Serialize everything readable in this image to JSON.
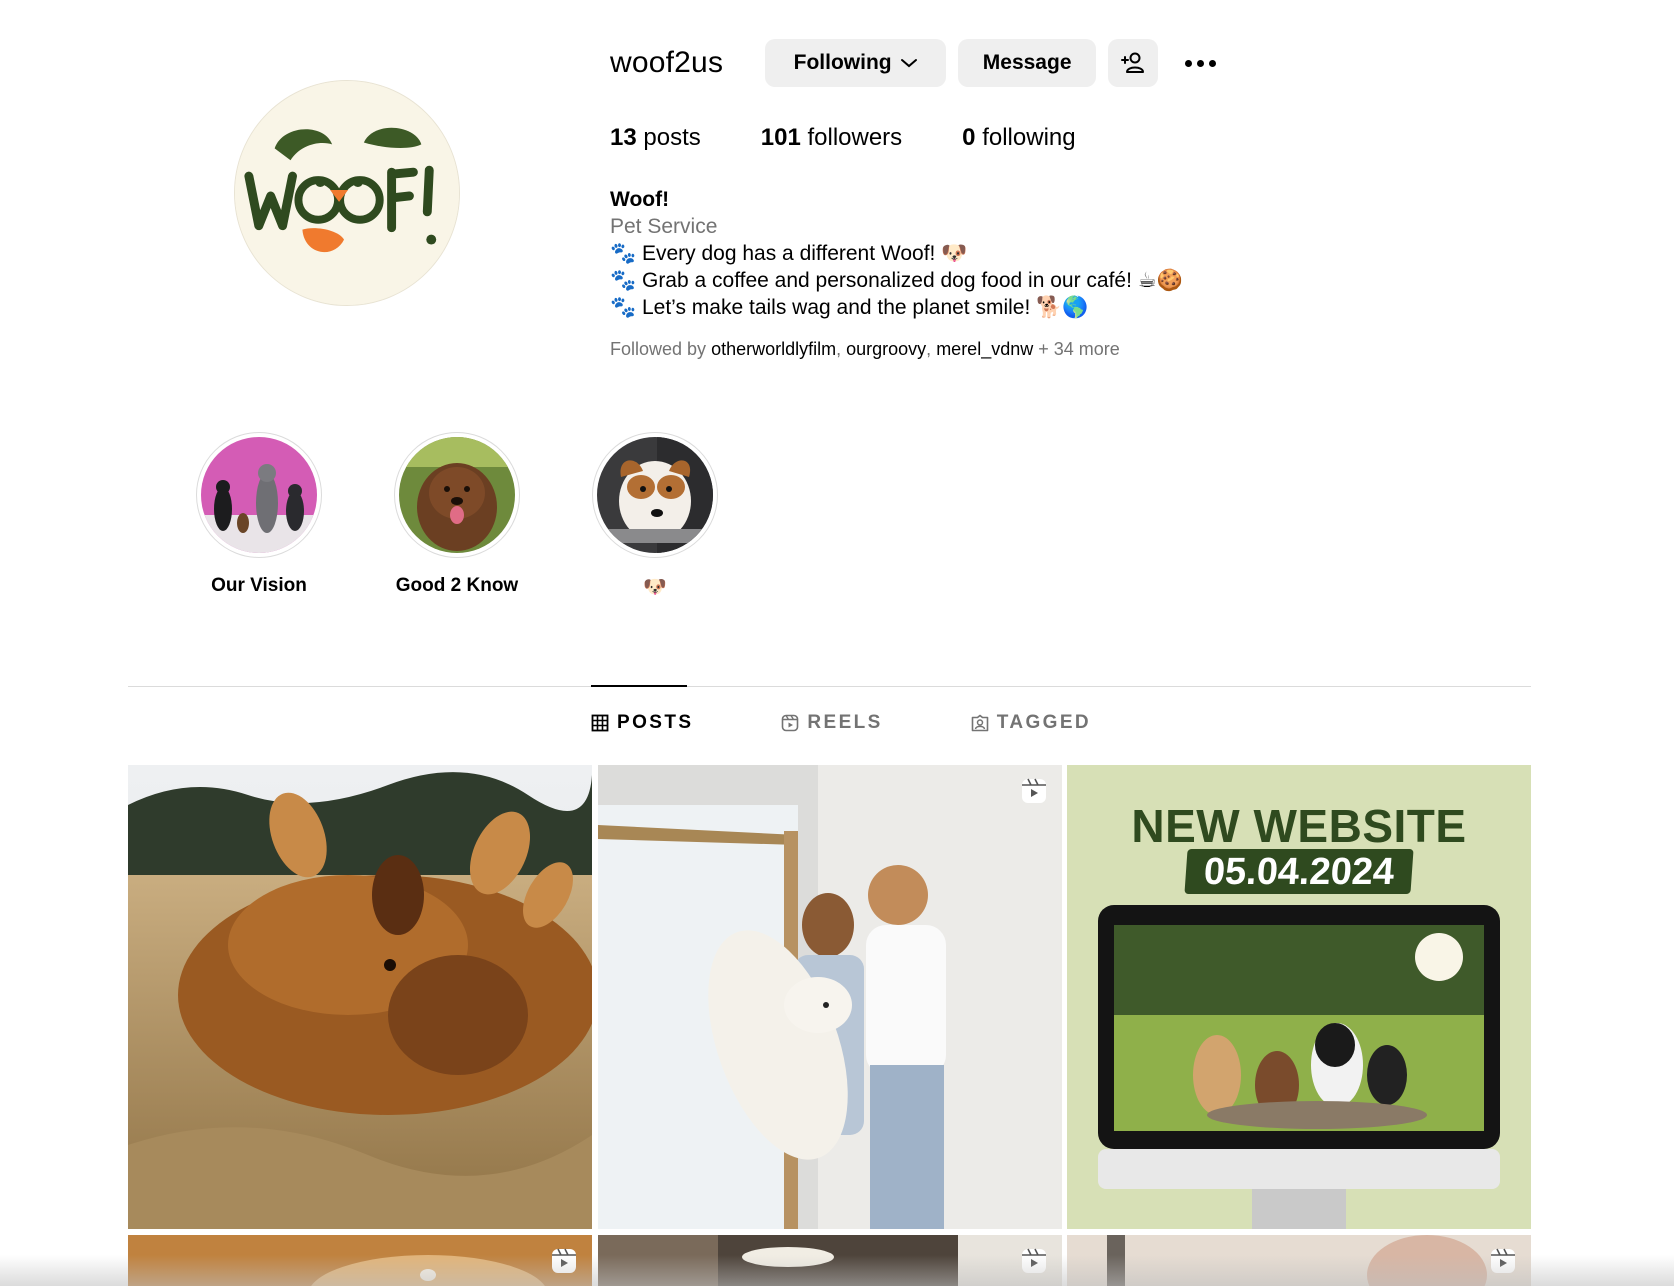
{
  "profile": {
    "username": "woof2us",
    "following_button": "Following",
    "message_button": "Message",
    "stats": {
      "posts_count": "13",
      "posts_label": "posts",
      "followers_count": "101",
      "followers_label": "followers",
      "following_count": "0",
      "following_label": "following"
    },
    "bio": {
      "name": "Woof!",
      "category": "Pet Service",
      "lines": [
        "🐾 Every dog has a different Woof! 🐶",
        "🐾 Grab a coffee and personalized dog food in our café! ☕🍪",
        "🐾 Let’s make tails wag and the planet smile! 🐕🌎"
      ]
    },
    "followed_by": {
      "prefix": "Followed by",
      "accounts": [
        "otherworldlyfilm",
        "ourgroovy",
        "merel_vdnw"
      ],
      "suffix": "+ 34 more"
    },
    "avatar_text": "WOOF!"
  },
  "highlights": [
    {
      "label": "Our Vision"
    },
    {
      "label": "Good 2 Know"
    },
    {
      "label": "🐶"
    }
  ],
  "tabs": [
    {
      "label": "POSTS",
      "icon": "grid-icon",
      "active": true
    },
    {
      "label": "REELS",
      "icon": "reels-icon",
      "active": false
    },
    {
      "label": "TAGGED",
      "icon": "tagged-icon",
      "active": false
    }
  ],
  "posts": {
    "website_post": {
      "title": "NEW WEBSITE",
      "date": "05.04.2024"
    }
  },
  "colors": {
    "button_bg": "#efefef",
    "muted_text": "#737373",
    "brand_green": "#2f4a1f",
    "website_bg": "#d7e0b6"
  }
}
